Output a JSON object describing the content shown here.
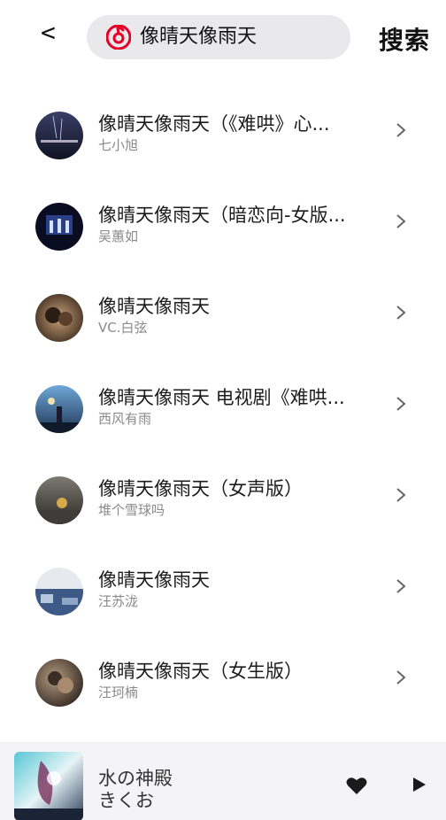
{
  "header": {
    "back_label": "<",
    "search_value": "像晴天像雨天",
    "search_button": "搜索",
    "logo_icon": "netease-music-icon",
    "accent": "#e60026"
  },
  "results": [
    {
      "title": "像晴天像雨天（《难哄》心...",
      "artist": "七小旭"
    },
    {
      "title": "像晴天像雨天（暗恋向-女版...",
      "artist": "吴蕙如"
    },
    {
      "title": "像晴天像雨天",
      "artist": "VC.白弦"
    },
    {
      "title": "像晴天像雨天 电视剧《难哄...",
      "artist": "西风有雨"
    },
    {
      "title": "像晴天像雨天（女声版）",
      "artist": "堆个雪球吗"
    },
    {
      "title": "像晴天像雨天",
      "artist": "汪苏泷"
    },
    {
      "title": "像晴天像雨天（女生版）",
      "artist": "汪珂楠"
    }
  ],
  "player": {
    "title": "水の神殿",
    "artist": "きくお",
    "heart_icon": "heart-icon",
    "play_icon": "play-icon"
  }
}
